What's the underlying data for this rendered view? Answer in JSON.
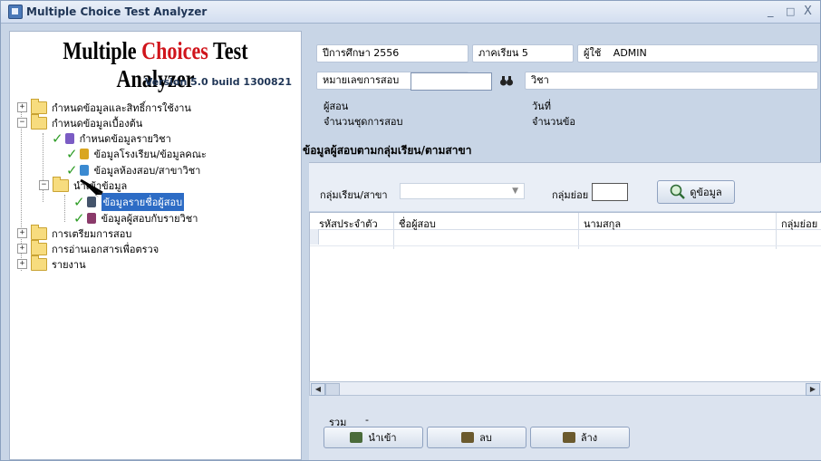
{
  "window": {
    "title": "Multiple Choice Test Analyzer",
    "minimize": "_",
    "maximize": "□",
    "close": "X"
  },
  "logo": {
    "part1": "Multiple ",
    "part2": "Choices",
    "part3": " Test Analyzer",
    "version": "Version 5.0  build 1300821"
  },
  "tree": {
    "items": [
      {
        "label": "กำหนดข้อมูลและสิทธิ์การใช้งาน",
        "expander": "+"
      },
      {
        "label": "กำหนดข้อมูลเบื้องต้น",
        "expander": "−"
      },
      {
        "label": "กำหนดข้อมูลรายวิชา"
      },
      {
        "label": "ข้อมูลโรงเรียน/ข้อมูลคณะ"
      },
      {
        "label": "ข้อมูลห้องสอบ/สาขาวิชา"
      },
      {
        "label": "นำเข้าข้อมูล",
        "expander": "−"
      },
      {
        "label": "ข้อมูลรายชื่อผู้สอบ"
      },
      {
        "label": "ข้อมูลผู้สอบกับรายวิชา"
      },
      {
        "label": "การเตรียมการสอบ",
        "expander": "+"
      },
      {
        "label": "การอ่านเอกสารเพื่อตรวจ",
        "expander": "+"
      },
      {
        "label": "รายงาน",
        "expander": "+"
      }
    ]
  },
  "info": {
    "academic_year": "ปีการศึกษา  2556",
    "semester": "ภาคเรียน  5",
    "user_label": "ผู้ใช้",
    "user_value": "ADMIN",
    "exam_no_label": "หมายเลขการสอบ",
    "exam_no_value": "",
    "subject_label": "วิชา",
    "teacher_label": "ผู้สอน",
    "date_label": "วันที่",
    "set_count_label": "จำนวนชุดการสอบ",
    "item_count_label": "จำนวนข้อ"
  },
  "section": {
    "title": "ข้อมูลผู้สอบตามกลุ่มเรียน/ตามสาขา"
  },
  "filter": {
    "group_label": "กลุ่มเรียน/สาขา",
    "group_value": "",
    "subgroup_label": "กลุ่มย่อย",
    "subgroup_value": "",
    "view_button": "ดูข้อมูล"
  },
  "grid": {
    "columns": [
      "รหัสประจำตัว",
      "ชื่อผู้สอบ",
      "นามสกุล",
      "กลุ่มย่อย"
    ],
    "rows": []
  },
  "footer": {
    "total_label": "รวม",
    "total_value": "-",
    "import_button": "นำเข้า",
    "delete_button": "ลบ",
    "clear_button": "ล้าง"
  },
  "colors": {
    "accent": "#2d6cc5",
    "logo_red": "#d0141b",
    "check_green": "#2f9d27"
  }
}
